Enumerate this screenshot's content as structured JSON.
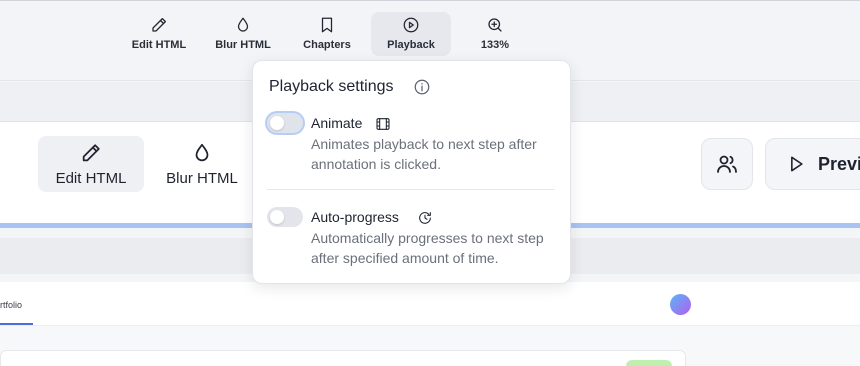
{
  "toolbar": {
    "items": [
      {
        "label": "Edit HTML",
        "icon": "pencil-icon"
      },
      {
        "label": "Blur HTML",
        "icon": "droplet-icon"
      },
      {
        "label": "Chapters",
        "icon": "bookmark-icon"
      },
      {
        "label": "Playback",
        "icon": "play-circle-icon",
        "active": true
      },
      {
        "label": "133%",
        "icon": "zoom-in-icon"
      }
    ]
  },
  "background": {
    "edit_label": "Edit HTML",
    "blur_label": "Blur HTML",
    "preview_label": "Previ",
    "tab_label": "rtfolio"
  },
  "playback": {
    "title": "Playback settings",
    "animate": {
      "label": "Animate",
      "description": "Animates playback to next step after annotation is clicked.",
      "enabled": false
    },
    "auto_progress": {
      "label": "Auto-progress",
      "description": "Automatically progresses to next step after specified amount of time.",
      "enabled": false
    }
  },
  "colors": {
    "accent_line": "#a9c3f2",
    "tab_underline": "#4b6fd6"
  }
}
